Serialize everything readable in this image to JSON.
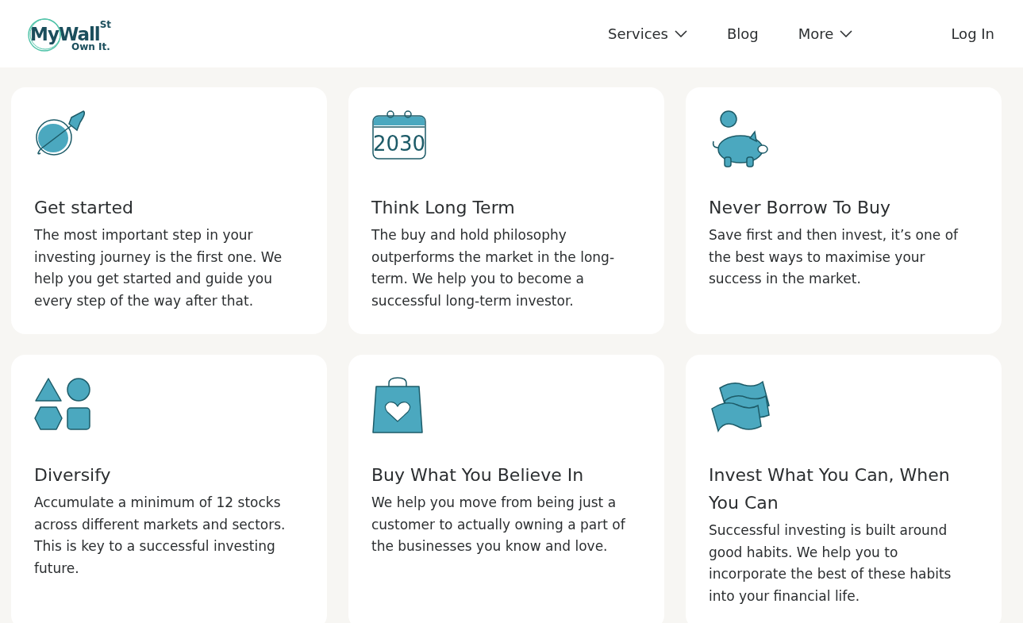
{
  "header": {
    "logo": {
      "name": "MyWall",
      "superscript": "St",
      "tagline": "Own It."
    },
    "nav": [
      {
        "label": "Services",
        "dropdown": true
      },
      {
        "label": "Blog",
        "dropdown": false
      },
      {
        "label": "More",
        "dropdown": true
      }
    ],
    "login": "Log In"
  },
  "cards": [
    {
      "kind": "rocket",
      "title": "Get started",
      "text": "The most important step in your investing journey is the first one. We help you get started and guide you every step of the way after that."
    },
    {
      "kind": "calendar",
      "icon_text": "2030",
      "title": "Think Long Term",
      "text": "The buy and hold philosophy outperforms the market in the long-term. We help you to become a successful long-term investor."
    },
    {
      "kind": "piggy",
      "title": "Never Borrow To Buy",
      "text": "Save first and then invest, it’s one of the best ways to maximise your success in the market."
    },
    {
      "kind": "shapes",
      "title": "Diversify",
      "text": "Accumulate a minimum of 12 stocks across different markets and sectors. This is key to a successful investing future."
    },
    {
      "kind": "bag",
      "title": "Buy What You Believe In",
      "text": "We help you move from being just a customer to actually owning a part of the businesses you know and love."
    },
    {
      "kind": "money",
      "title": "Invest What You Can, When You Can",
      "text": "Successful investing is built around good habits. We help you to incorporate the best of these habits into your financial life."
    }
  ]
}
